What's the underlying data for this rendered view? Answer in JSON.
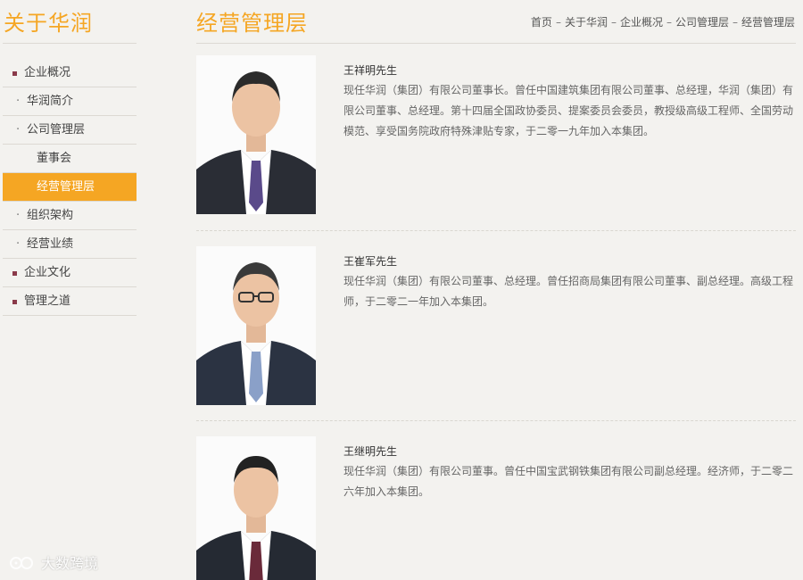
{
  "sidebar": {
    "title": "关于华润",
    "items": [
      {
        "label": "企业概况",
        "level": 1
      },
      {
        "label": "华润简介",
        "level": 2
      },
      {
        "label": "公司管理层",
        "level": 2
      },
      {
        "label": "董事会",
        "level": 3
      },
      {
        "label": "经营管理层",
        "level": 3,
        "active": true
      },
      {
        "label": "组织架构",
        "level": 2
      },
      {
        "label": "经营业绩",
        "level": 2
      },
      {
        "label": "企业文化",
        "level": 1
      },
      {
        "label": "管理之道",
        "level": 1
      }
    ]
  },
  "page": {
    "title": "经营管理层",
    "breadcrumb": [
      "首页",
      "关于华润",
      "企业概况",
      "公司管理层",
      "经营管理层"
    ],
    "breadcrumb_separator": "–"
  },
  "executives": [
    {
      "name": "王祥明先生",
      "bio": "现任华润（集团）有限公司董事长。曾任中国建筑集团有限公司董事、总经理，华润（集团）有限公司董事、总经理。第十四届全国政协委员、提案委员会委员，教授级高级工程师、全国劳动模范、享受国务院政府特殊津贴专家，于二零一九年加入本集团。",
      "tie_color": "#5a4a8a"
    },
    {
      "name": "王崔军先生",
      "bio": "现任华润（集团）有限公司董事、总经理。曾任招商局集团有限公司董事、副总经理。高级工程师，于二零二一年加入本集团。",
      "tie_color": "#8aa0c8"
    },
    {
      "name": "王继明先生",
      "bio": "现任华润（集团）有限公司董事。曾任中国宝武钢铁集团有限公司副总经理。经济师，于二零二六年加入本集团。",
      "tie_color": "#6a2a3a"
    }
  ],
  "watermark": {
    "text": "大数跨境"
  },
  "colors": {
    "accent": "#f5a623",
    "background": "#f3f2ef",
    "bullet": "#8a3a4a"
  }
}
